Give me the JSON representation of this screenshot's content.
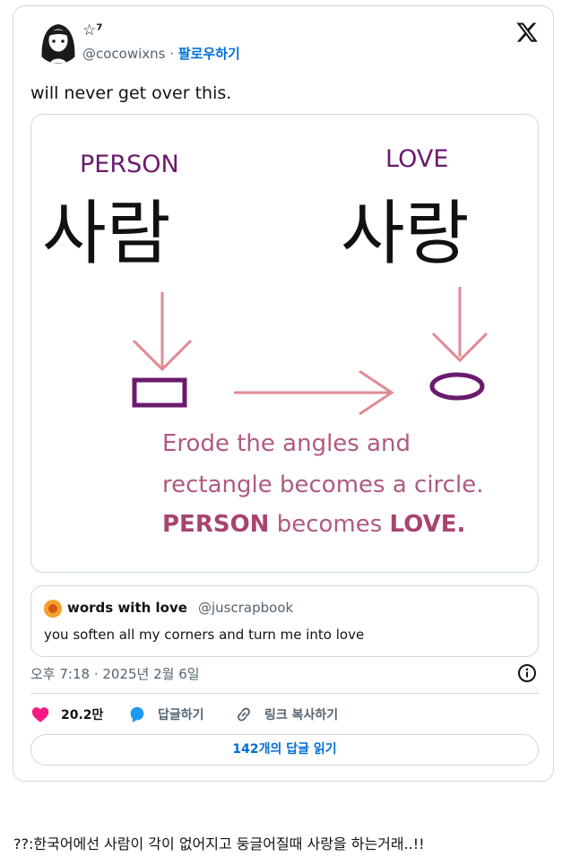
{
  "tweet": {
    "display_name": "☆⁷",
    "handle": "@cocowixns",
    "separator": "·",
    "follow_label": "팔로우하기",
    "text": "will never get over this.",
    "logo_icon": "x-logo-icon",
    "image": {
      "label_left": "PERSON",
      "label_right": "LOVE",
      "word_left": "사람",
      "word_right": "사랑",
      "shape_left": "ㅁ",
      "shape_right": "ㅇ",
      "caption_line1": "Erode the angles and",
      "caption_line2": "rectangle becomes a circle.",
      "caption_line3_a": "PERSON",
      "caption_line3_b": " becomes ",
      "caption_line3_c": "LOVE.",
      "arrow_color": "#e08a94",
      "shape_color": "#6a1b6e",
      "caption_color": "#b05a7e"
    },
    "quote": {
      "name": "words with love",
      "handle": "@juscrapbook",
      "text": "you soften all my corners and turn me into love"
    },
    "timestamp": "오후 7:18 · 2025년 2월 6일",
    "likes": "20.2만",
    "reply_label": "답글하기",
    "copy_link_label": "링크 복사하기",
    "read_replies_label": "142개의 답글 읽기",
    "colors": {
      "like": "#f91880",
      "reply": "#1d9bf0",
      "link": "#006fd6",
      "muted": "#536471",
      "border": "#cfd9de"
    }
  },
  "comment": "??:한국어에선 사람이 각이 없어지고 둥글어질때 사랑을 하는거래..!!"
}
